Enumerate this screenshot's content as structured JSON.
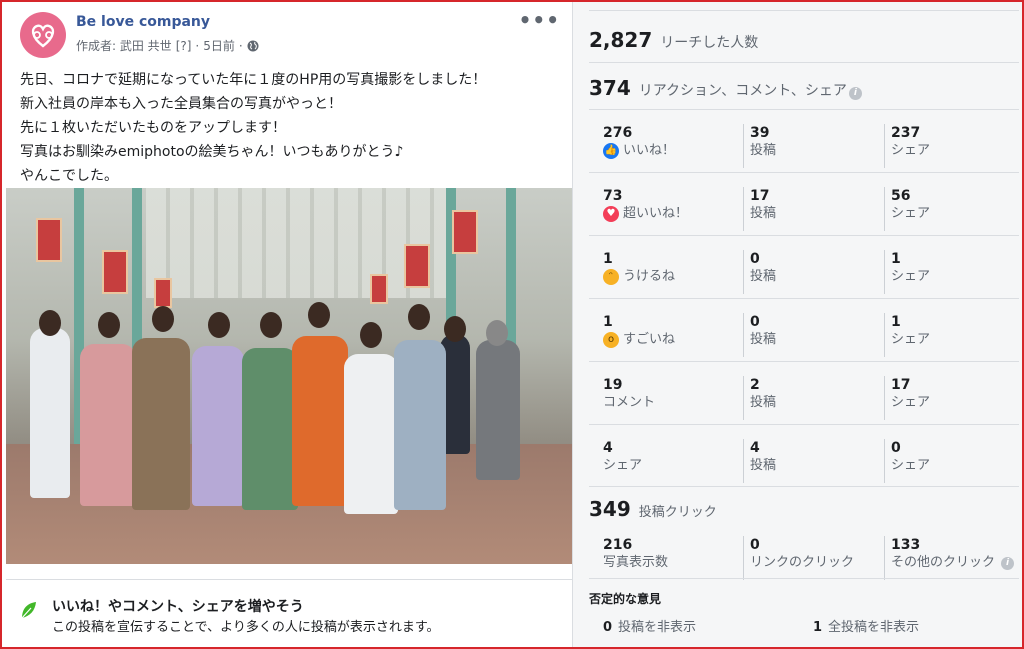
{
  "post": {
    "page_name": "Be love company",
    "author_label": "作成者: 武田 共世",
    "help_mark": "[?]",
    "time": "5日前",
    "text_lines": [
      "先日、コロナで延期になっていた年に１度のHP用の写真撮影をしました！",
      "新入社員の岸本も入った全員集合の写真がやっと！",
      "先に１枚いただいたものをアップします！",
      "写真はお馴染みemiphotoの絵美ちゃん！いつもありがとう♪",
      "やんこでした。"
    ],
    "promo_title": "いいね！やコメント、シェアを増やそう",
    "promo_desc": "この投稿を宣伝することで、より多くの人に投稿が表示されます。"
  },
  "insights": {
    "reach_num": "2,827",
    "reach_label": "リーチした人数",
    "engagement_num": "374",
    "engagement_label": "リアクション、コメント、シェア",
    "rows": [
      {
        "c1_num": "276",
        "c1_label": "いいね！",
        "c1_icon": "like-icon",
        "c2_num": "39",
        "c2_label": "投稿",
        "c3_num": "237",
        "c3_label": "シェア"
      },
      {
        "c1_num": "73",
        "c1_label": "超いいね！",
        "c1_icon": "love-icon",
        "c2_num": "17",
        "c2_label": "投稿",
        "c3_num": "56",
        "c3_label": "シェア"
      },
      {
        "c1_num": "1",
        "c1_label": "うけるね",
        "c1_icon": "haha-icon",
        "c2_num": "0",
        "c2_label": "投稿",
        "c3_num": "1",
        "c3_label": "シェア"
      },
      {
        "c1_num": "1",
        "c1_label": "すごいね",
        "c1_icon": "wow-icon",
        "c2_num": "0",
        "c2_label": "投稿",
        "c3_num": "1",
        "c3_label": "シェア"
      },
      {
        "c1_num": "19",
        "c1_label": "コメント",
        "c2_num": "2",
        "c2_label": "投稿",
        "c3_num": "17",
        "c3_label": "シェア"
      },
      {
        "c1_num": "4",
        "c1_label": "シェア",
        "c2_num": "4",
        "c2_label": "投稿",
        "c3_num": "0",
        "c3_label": "シェア"
      }
    ],
    "clicks_num": "349",
    "clicks_label": "投稿クリック",
    "clicks": {
      "photo_num": "216",
      "photo_label": "写真表示数",
      "link_num": "0",
      "link_label": "リンクのクリック",
      "other_num": "133",
      "other_label": "その他のクリック"
    },
    "negative_title": "否定的な意見",
    "negative": {
      "hide_post_num": "0",
      "hide_post_label": "投稿を非表示",
      "hide_all_num": "1",
      "hide_all_label": "全投稿を非表示"
    },
    "colors": {
      "like": "#1877f2",
      "love": "#f33e58",
      "haha": "#f7b125",
      "wow": "#f7b125"
    }
  }
}
